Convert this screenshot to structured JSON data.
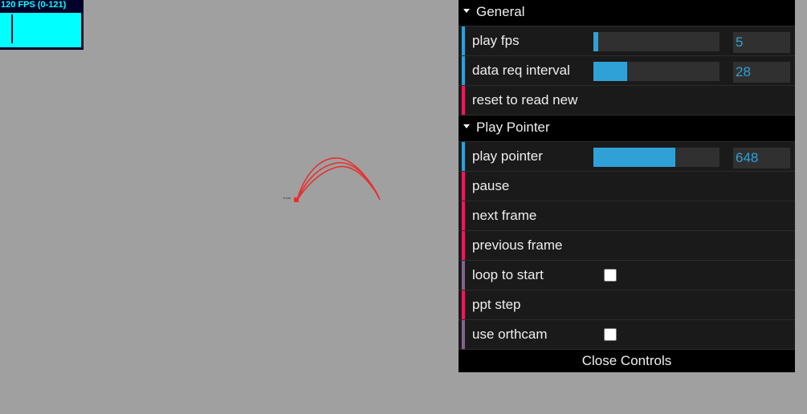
{
  "stats": {
    "fps_text": "120 FPS (0-121)"
  },
  "scene": {
    "marker_label": "e-ion"
  },
  "gui": {
    "general": {
      "title": "General",
      "play_fps": {
        "label": "play fps",
        "value": "5",
        "fill": 0.04
      },
      "data_req_interval": {
        "label": "data req interval",
        "value": "28",
        "fill": 0.27
      },
      "reset": {
        "label": "reset to read new"
      }
    },
    "play_pointer_folder": {
      "title": "Play Pointer",
      "play_pointer": {
        "label": "play pointer",
        "value": "648",
        "fill": 0.65
      },
      "pause": {
        "label": "pause"
      },
      "next_frame": {
        "label": "next frame"
      },
      "previous_frame": {
        "label": "previous frame"
      },
      "loop_to_start": {
        "label": "loop to start",
        "checked": false
      },
      "ppt_step": {
        "label": "ppt step"
      },
      "use_orthcam": {
        "label": "use orthcam",
        "checked": false
      }
    },
    "close_label": "Close Controls"
  },
  "colors": {
    "background": "#a0a0a0",
    "number_accent": "#2fa1d6",
    "function_accent": "#e61d5f",
    "boolean_accent": "#806787",
    "trajectory": "#e53030"
  }
}
